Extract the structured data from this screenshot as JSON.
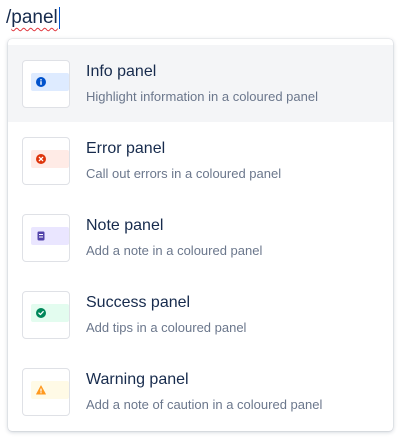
{
  "editor": {
    "slash": "/",
    "query": "panel"
  },
  "menu": {
    "items": [
      {
        "title": "Info panel",
        "description": "Highlight information in a coloured panel",
        "icon": "info-icon",
        "strip_color": "#deebff",
        "icon_color": "#0052cc"
      },
      {
        "title": "Error panel",
        "description": "Call out errors in a coloured panel",
        "icon": "error-icon",
        "strip_color": "#ffebe6",
        "icon_color": "#de350b"
      },
      {
        "title": "Note panel",
        "description": "Add a note in a coloured panel",
        "icon": "note-icon",
        "strip_color": "#eae6ff",
        "icon_color": "#5243aa"
      },
      {
        "title": "Success panel",
        "description": "Add tips in a coloured panel",
        "icon": "success-icon",
        "strip_color": "#e3fcef",
        "icon_color": "#00875a"
      },
      {
        "title": "Warning panel",
        "description": "Add a note of caution in a coloured panel",
        "icon": "warning-icon",
        "strip_color": "#fffae6",
        "icon_color": "#ff991f"
      }
    ]
  }
}
